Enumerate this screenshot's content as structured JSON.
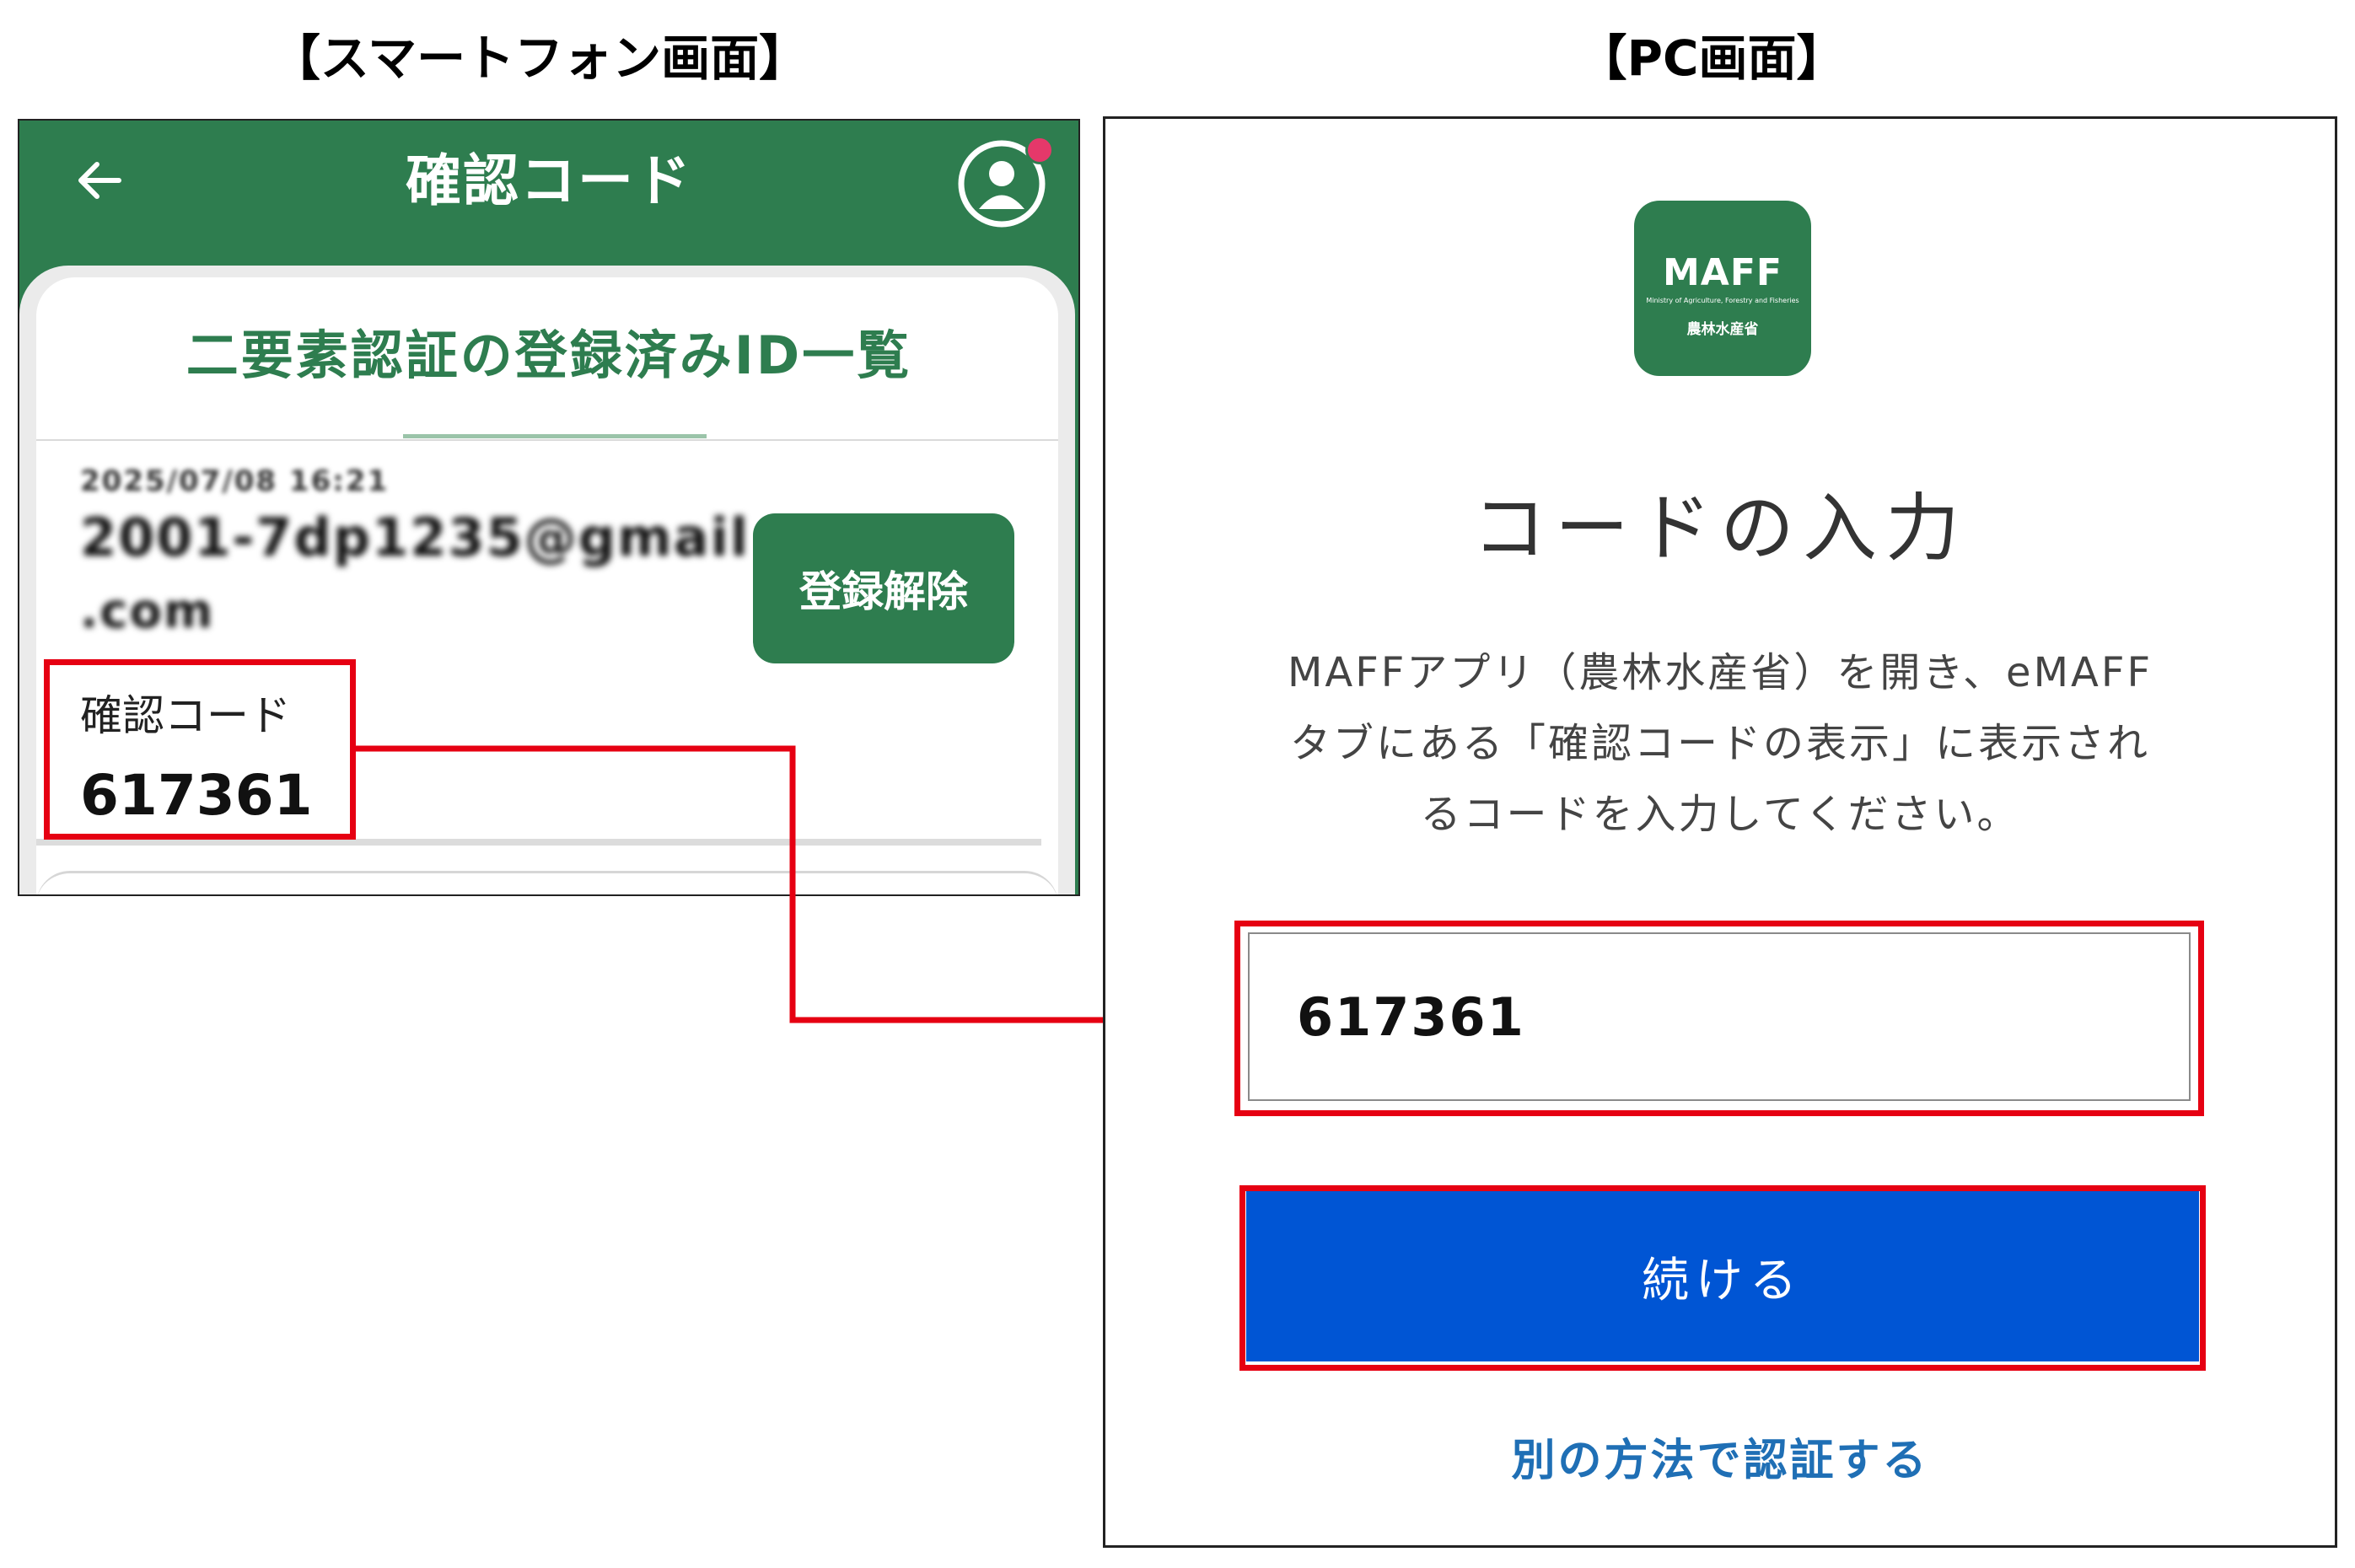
{
  "headings": {
    "phone": "【スマートフォン画面】",
    "pc": "【PC画面】"
  },
  "phone": {
    "title": "確認コード",
    "card_title": "二要素認証の登録済みID一覧",
    "reg_date": "2025/07/08 16:21",
    "reg_email_line1": "2001-7dp1235@gmail",
    "reg_email_line2": ".com",
    "unregister_label": "登録解除",
    "code_label": "確認コード",
    "code_value": "617361"
  },
  "pc": {
    "logo_text": "MAFF",
    "logo_sub": "Ministry of Agriculture, Forestry and Fisheries",
    "logo_jp": "農林水産省",
    "title": "コードの入力",
    "instructions_line1": "MAFFアプリ（農林水産省）を開き、eMAFF",
    "instructions_line2": "タブにある「確認コードの表示」に表示され",
    "instructions_line3": "るコードを入力してください。",
    "code_input_value": "617361",
    "continue_label": "続ける",
    "alt_link": "別の方法で認証する"
  },
  "colors": {
    "brand_green": "#2e7d4f",
    "primary_blue": "#0055d4",
    "highlight_red": "#e60012",
    "link_blue": "#1f6fb5"
  },
  "icons": {
    "back": "arrow-left-icon",
    "account": "user-circle-icon"
  }
}
